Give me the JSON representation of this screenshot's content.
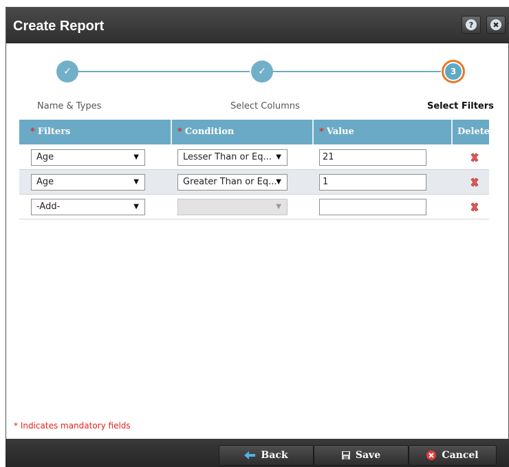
{
  "dialog": {
    "title": "Create Report",
    "help_icon": "help-icon",
    "close_icon": "close-icon"
  },
  "stepper": {
    "steps": [
      {
        "label": "Name & Types",
        "state": "completed",
        "icon": "check-icon"
      },
      {
        "label": "Select Columns",
        "state": "completed",
        "icon": "check-icon"
      },
      {
        "label": "Select Filters",
        "state": "active",
        "number": "3"
      }
    ],
    "colors": {
      "line": "#6fa9c4",
      "circle": "#72afc9",
      "active_ring": "#ea7a25"
    }
  },
  "table": {
    "columns": [
      {
        "label": "Filters",
        "required": true
      },
      {
        "label": "Condition",
        "required": true
      },
      {
        "label": "Value",
        "required": true
      },
      {
        "label": "Delete",
        "required": false
      }
    ],
    "required_marker": "*",
    "rows": [
      {
        "filter": "Age",
        "condition": "Lesser Than or Eq...",
        "condition_disabled": false,
        "value": "21"
      },
      {
        "filter": "Age",
        "condition": "Greater Than or Eq...",
        "condition_disabled": false,
        "value": "1"
      },
      {
        "filter": "-Add-",
        "condition": "",
        "condition_disabled": true,
        "value": ""
      }
    ],
    "dropdown_arrow": "▼",
    "header_color": "#6aaac6"
  },
  "mandatory_note": "* Indicates mandatory fields",
  "footer": {
    "back_label": "Back",
    "save_label": "Save",
    "cancel_label": "Cancel"
  }
}
